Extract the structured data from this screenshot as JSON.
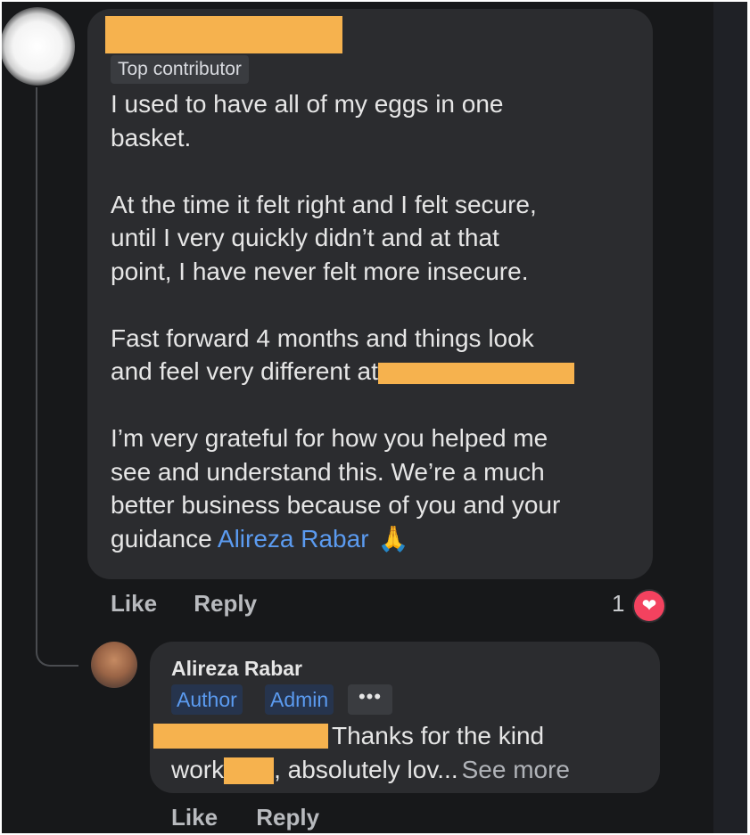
{
  "comment": {
    "badge": "Top contributor",
    "paragraphs": [
      "I used to have all of my eggs in one\nbasket.",
      "At the time it felt right and I felt secure,\nuntil I very quickly didn’t and at that\npoint, I have never felt more insecure.",
      "Fast forward 4 months and things look\nand feel very different at",
      "I’m very grateful for how you helped me\nsee and understand this. We’re a much\nbetter business because of you and your\nguidance"
    ],
    "mention": "Alireza Rabar",
    "emoji": "🙏",
    "actions": {
      "like": "Like",
      "reply": "Reply"
    },
    "reaction_count": "1",
    "reaction_icon": "heart-icon"
  },
  "reply": {
    "author": "Alireza Rabar",
    "badges": [
      "Author",
      "Admin"
    ],
    "more": "•••",
    "text_line1": "Thanks for the kind",
    "text_line2_a": "work",
    "text_line2_b": ", absolutely lov...",
    "see_more": "See more",
    "actions": {
      "like": "Like",
      "reply": "Reply"
    }
  },
  "colors": {
    "background": "#17181a",
    "bubble": "#2b2c2f",
    "mention": "#5b9bf0",
    "redaction": "#f6b24e",
    "heart": "#f3425f"
  }
}
